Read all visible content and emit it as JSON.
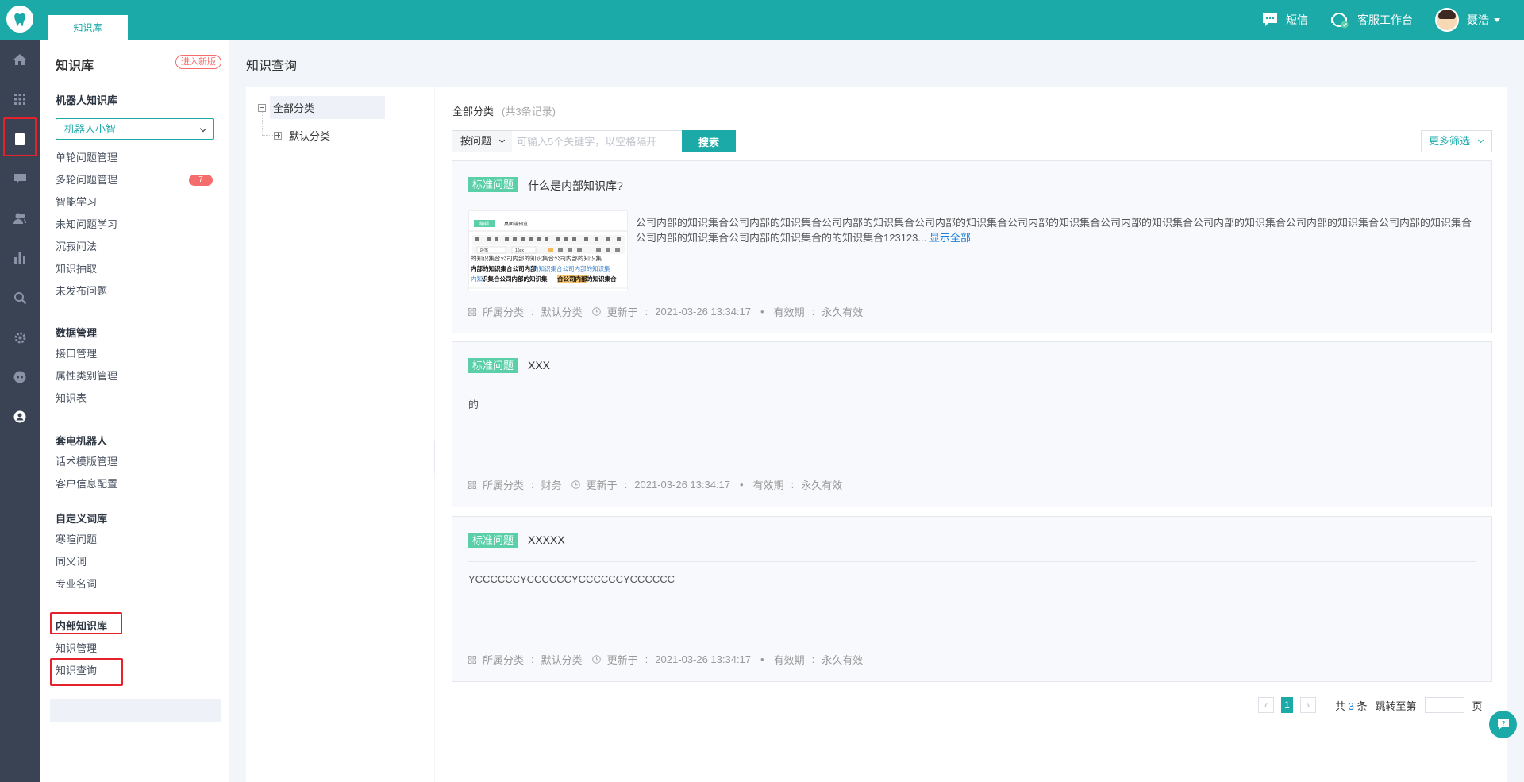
{
  "topbar": {
    "tab": "知识库",
    "sms": "短信",
    "workbench": "客服工作台",
    "user": "聂浩"
  },
  "sidebar": {
    "title": "知识库",
    "new_version": "进入新版",
    "groups": {
      "robot": "机器人知识库",
      "data": "数据管理",
      "call": "套电机器人",
      "dict": "自定义词库",
      "internal": "内部知识库"
    },
    "robot_select": "机器人小智",
    "robot_items": [
      "单轮问题管理",
      "多轮问题管理",
      "智能学习",
      "未知问题学习",
      "沉寂问法",
      "知识抽取",
      "未发布问题"
    ],
    "multi_badge": "7",
    "data_items": [
      "接口管理",
      "属性类别管理",
      "知识表"
    ],
    "call_items": [
      "话术模版管理",
      "客户信息配置"
    ],
    "dict_items": [
      "寒暄问题",
      "同义词",
      "专业名词"
    ],
    "internal_items": [
      "知识管理",
      "知识查询"
    ]
  },
  "page": {
    "title": "知识查询"
  },
  "tree": {
    "root": "全部分类",
    "child": "默认分类"
  },
  "list": {
    "crumb": "全部分类",
    "count": "(共3条记录)",
    "search_type": "按问题",
    "search_placeholder": "可输入5个关键字，以空格隔开",
    "search_btn": "搜索",
    "more_filter": "更多筛选"
  },
  "cards": [
    {
      "tag": "标准问题",
      "title": "什么是内部知识库?",
      "body": "公司内部的知识集合公司内部的知识集合公司内部的知识集合公司内部的知识集合公司内部的知识集合公司内部的知识集合公司内部的知识集合公司内部的知识集合公司内部的知识集合公司内部的知识集合公司内部的知识集合的的知识集合123123...",
      "show_all": "显示全部",
      "category_label": "所属分类",
      "category": "默认分类",
      "updated_label": "更新于",
      "updated": "2021-03-26 13:34:17",
      "valid_label": "有效期",
      "valid": "永久有效"
    },
    {
      "tag": "标准问题",
      "title": "XXX",
      "body": "的",
      "category_label": "所属分类",
      "category": "财务",
      "updated_label": "更新于",
      "updated": "2021-03-26 13:34:17",
      "valid_label": "有效期",
      "valid": "永久有效"
    },
    {
      "tag": "标准问题",
      "title": "XXXXX",
      "body": "YCCCCCCYCCCCCCYCCCCCCYCCCCCC",
      "category_label": "所属分类",
      "category": "默认分类",
      "updated_label": "更新于",
      "updated": "2021-03-26 13:34:17",
      "valid_label": "有效期",
      "valid": "永久有效"
    }
  ],
  "thumb": {
    "tab_active": "编辑",
    "tab_preview": "桌面端预览",
    "font_select": "段落",
    "size_select": "16px",
    "line1": "的知识集合公司内部的知识集合公司内部的知识集",
    "line2a": "内部的知识集合公司内部",
    "line2b": "的知识集合公司内部的知识集",
    "line3a": "内知",
    "line3b": "识集合公司内部的知识集",
    "line3c": "合公司内部",
    "line3d": "的知识集合"
  },
  "pager": {
    "prev": "‹",
    "current": "1",
    "next": "›",
    "total_prefix": "共",
    "total": "3",
    "total_suffix": "条",
    "jump_prefix": "跳转至第",
    "jump_suffix": "页"
  },
  "colors": {
    "brand": "#1baaa8",
    "tag": "#5bcfa8",
    "badge": "#f56c6c",
    "highlight": "#e5212b"
  }
}
